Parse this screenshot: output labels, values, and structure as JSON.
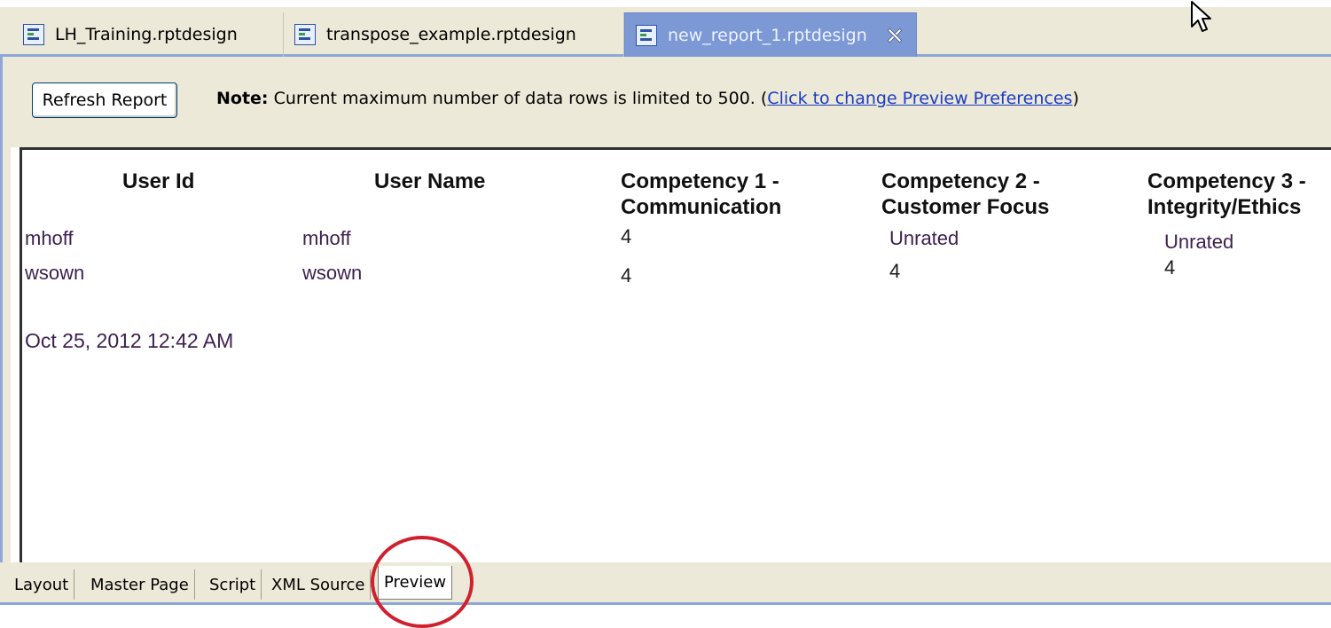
{
  "editor_tabs": [
    {
      "label": "LH_Training.rptdesign",
      "active": false
    },
    {
      "label": "transpose_example.rptdesign",
      "active": false
    },
    {
      "label": "new_report_1.rptdesign",
      "active": true
    }
  ],
  "toolbar": {
    "refresh_label": "Refresh Report",
    "note_bold": "Note:",
    "note_text": " Current maximum number of data rows is limited to 500. (",
    "note_link": "Click to change Preview Preferences",
    "note_close": ")"
  },
  "report": {
    "columns": [
      {
        "line1": "User Id",
        "line2": ""
      },
      {
        "line1": "User Name",
        "line2": ""
      },
      {
        "line1": "Competency 1 -",
        "line2": "Communication"
      },
      {
        "line1": "Competency 2 -",
        "line2": "Customer Focus"
      },
      {
        "line1": "Competency 3 -",
        "line2": "Integrity/Ethics"
      }
    ],
    "rows": [
      [
        "mhoff",
        "mhoff",
        "4",
        "Unrated",
        "Unrated"
      ],
      [
        "wsown",
        "wsown",
        "4",
        "4",
        "4"
      ]
    ],
    "timestamp": "Oct 25, 2012 12:42 AM"
  },
  "bottom_tabs": [
    {
      "label": "Layout"
    },
    {
      "label": "Master Page"
    },
    {
      "label": "Script"
    },
    {
      "label": "XML Source"
    },
    {
      "label": "Preview"
    }
  ],
  "colors": {
    "active_tab": "#7c99d6",
    "panel_bg": "#ece9d8",
    "link": "#1a3cc2",
    "highlight_circle": "#d0202e"
  },
  "icons": {
    "doc": "report-design-icon",
    "close": "close-icon",
    "cursor": "mouse-cursor-icon"
  }
}
